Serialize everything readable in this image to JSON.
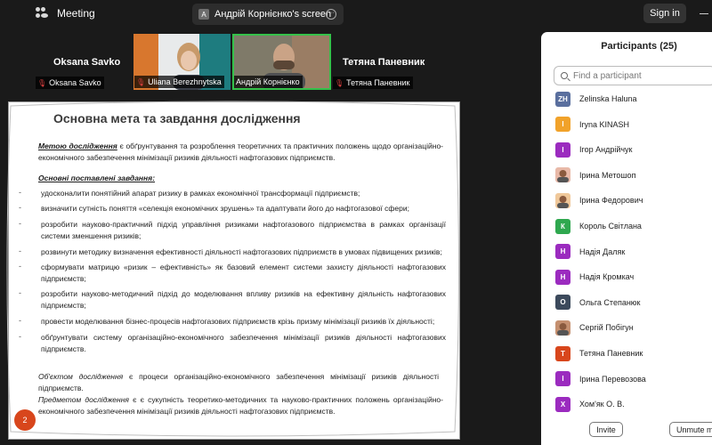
{
  "app": {
    "title": "Meeting"
  },
  "share_tab": {
    "badge": "A",
    "label": "Андрій Корнієнко's screen"
  },
  "signin_label": "Sign in",
  "gallery": {
    "left_big_name": "Oksana Savko",
    "left_tag": "Oksana Savko",
    "tile1_tag": "Uliana Berezhnytska",
    "tile2_tag": "Андрій Корнієнко",
    "right_big_name": "Тетяна Паневник",
    "right_tag": "Тетяна Паневник"
  },
  "slide": {
    "title": "Основна мета та завдання дослідження",
    "purpose_label": "Метою дослідження",
    "purpose_text": " є обґрунтування та розроблення теоретичних та практичних  положень щодо організаційно-економічного забезпечення мінімізації ризиків діяльності нафтогазових підприємств.",
    "tasks_heading": "Основні поставлені завдання:",
    "tasks": [
      "удосконалити понятійний апарат ризику в рамках економічної трансформації підприємств;",
      "визначити сутність поняття «селекція економічних зрушень» та адаптувати його до нафтогазової сфери;",
      "розробити науково-практичний підхід управління ризиками нафтогазового підприємства в рамках організації системи зменшення ризиків;",
      "розвинути методику визначення ефективності діяльності нафтогазових підприємств в умовах підвищених ризиків;",
      "сформувати матрицю «ризик – ефективність» як базовий елемент системи захисту діяльності нафтогазових підприємств;",
      "розробити науково-методичний підхід до моделювання впливу ризиків на ефективну діяльність нафтогазових підприємств;",
      "провести моделювання бізнес-процесів нафтогазових підприємств крізь призму мінімізації ризиків їх діяльності;",
      "обґрунтувати систему організаційно-економічного забезпечення мінімізації ризиків діяльності нафтогазових підприємств."
    ],
    "object_label": "Об'єктом дослідження",
    "object_text": " є процеси організаційно-економічного забезпечення мінімізації ризиків діяльності підприємств.",
    "subject_label": "Предметом дослідження",
    "subject_text": " є є сукупність теоретико-методичних та науково-практичних положень організаційно-економічного забезпечення мінімізації ризиків діяльності нафтогазових підприємств.",
    "page_number": "2"
  },
  "participants": {
    "title": "Participants (25)",
    "search_placeholder": "Find a participant",
    "items": [
      {
        "initials": "ZH",
        "color": "#5a6f9e",
        "name": "Zelinska Haluna"
      },
      {
        "initials": "I",
        "color": "#f1a22a",
        "name": "Iryna KINASH"
      },
      {
        "initials": "I",
        "color": "#9b2bbf",
        "name": "Ігор Андрійчук"
      },
      {
        "initials": "",
        "color": "#e8b9a8",
        "name": "Ірина Метошоп",
        "photo": true
      },
      {
        "initials": "",
        "color": "#f0c89a",
        "name": "Ірина Федорович",
        "photo": true
      },
      {
        "initials": "К",
        "color": "#2fa84f",
        "name": "Король Світлана"
      },
      {
        "initials": "Н",
        "color": "#9b2bbf",
        "name": "Надія Даляк"
      },
      {
        "initials": "Н",
        "color": "#9b2bbf",
        "name": "Надія Кромкач"
      },
      {
        "initials": "О",
        "color": "#3c4a5c",
        "name": "Ольга Степанюк"
      },
      {
        "initials": "",
        "color": "#c59070",
        "name": "Сергій Побігун",
        "photo": true
      },
      {
        "initials": "Т",
        "color": "#d8461c",
        "name": "Тетяна Паневник"
      },
      {
        "initials": "І",
        "color": "#9b2bbf",
        "name": "Ірина Перевозова"
      },
      {
        "initials": "Х",
        "color": "#9b2bbf",
        "name": "Хом'як О. В."
      }
    ],
    "invite_label": "Invite",
    "mute_label": "Unmute m"
  }
}
